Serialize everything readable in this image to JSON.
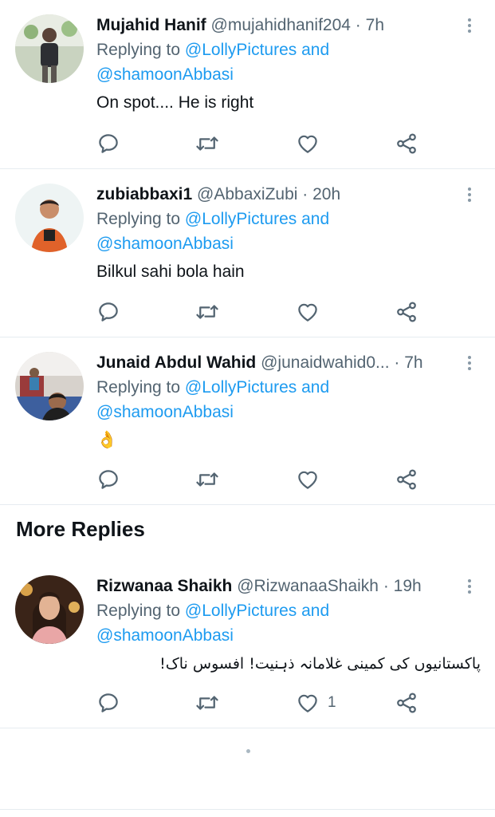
{
  "tweets": [
    {
      "name": "Mujahid Hanif",
      "handle": "@mujahidhanif204",
      "sep": "·",
      "time": "7h",
      "replying_prefix": "Replying to",
      "mention1": "@LollyPictures",
      "and_word": "and",
      "mention2": "@shamoonAbbasi",
      "text": "On spot.... He is right",
      "like_count": ""
    },
    {
      "name": "zubiabbaxi1",
      "handle": "@AbbaxiZubi",
      "sep": "·",
      "time": "20h",
      "replying_prefix": "Replying to",
      "mention1": "@LollyPictures",
      "and_word": "and",
      "mention2": "@shamoonAbbasi",
      "text": "Bilkul sahi bola hain",
      "like_count": ""
    },
    {
      "name": "Junaid Abdul Wahid",
      "handle": "@junaidwahid0...",
      "sep": "·",
      "time": "7h",
      "replying_prefix": "Replying to",
      "mention1": "@LollyPictures",
      "and_word": "and",
      "mention2": "@shamoonAbbasi",
      "text": "👌",
      "like_count": ""
    },
    {
      "name": "Rizwanaa Shaikh",
      "handle": "@RizwanaaShaikh",
      "sep": "·",
      "time": "19h",
      "replying_prefix": "Replying to",
      "mention1": "@LollyPictures",
      "and_word": "and",
      "mention2": "@shamoonAbbasi",
      "text": "پاکستانیوں کی کمینی غلامانہ ذہنیت! افسوس ناک!",
      "like_count": "1"
    }
  ],
  "section": {
    "more_replies": "More Replies"
  },
  "icons": {
    "reply": "reply-icon",
    "retweet": "retweet-icon",
    "like": "heart-icon",
    "share": "share-icon",
    "more": "more-vertical-icon"
  },
  "colors": {
    "link": "#1d9bf0",
    "secondary": "#536471",
    "text": "#0f1419",
    "divider": "#e6ecf0"
  }
}
